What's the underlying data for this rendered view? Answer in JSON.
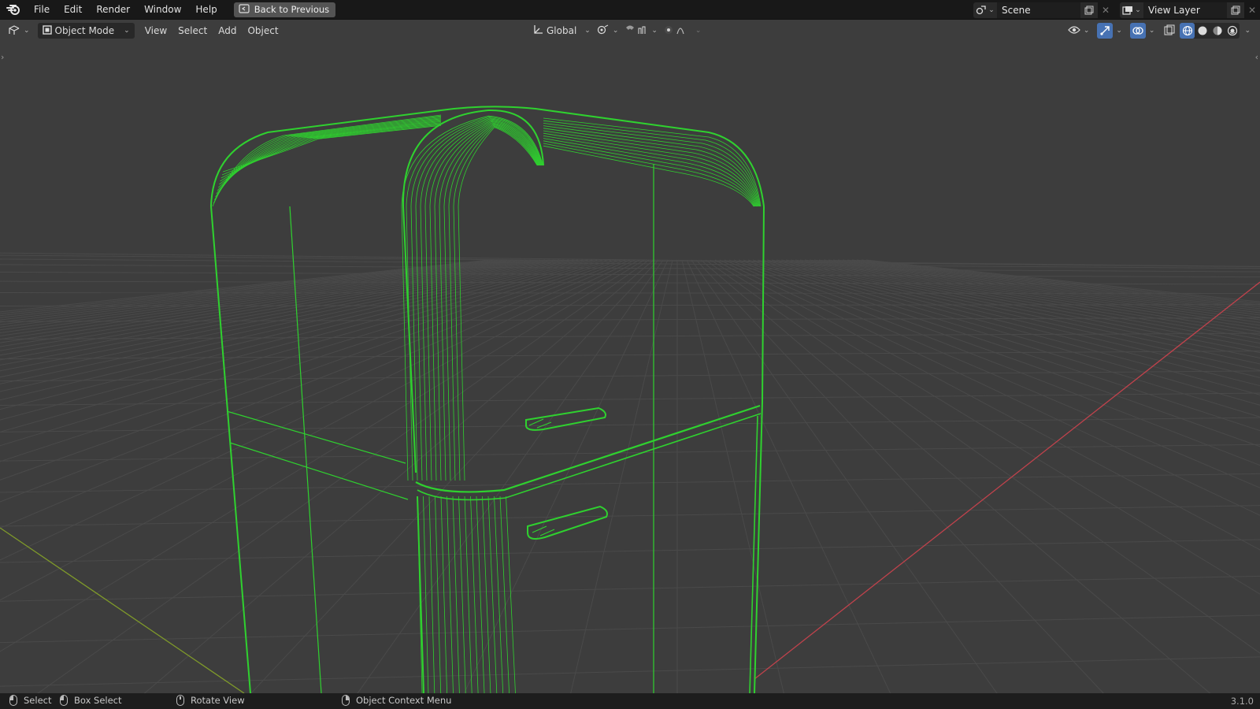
{
  "topbar": {
    "menus": [
      "File",
      "Edit",
      "Render",
      "Window",
      "Help"
    ],
    "back_label": "Back to Previous",
    "scene_name": "Scene",
    "view_layer_name": "View Layer"
  },
  "header": {
    "mode_label": "Object Mode",
    "menus": [
      "View",
      "Select",
      "Add",
      "Object"
    ],
    "orientation_label": "Global",
    "active_shading": "wireframe"
  },
  "statusbar": {
    "select": "Select",
    "box_select": "Box Select",
    "rotate_view": "Rotate View",
    "context_menu": "Object Context Menu",
    "version": "3.1.0"
  },
  "colors": {
    "wire": "#2fd12f",
    "x_axis": "#c0424c",
    "y_axis": "#7f9a2a",
    "grid": "#4a4a4a",
    "background": "#3d3d3d"
  },
  "icons": [
    "blender-logo-icon",
    "back-icon",
    "editor-type-icon",
    "object-mode-icon",
    "orientation-icon",
    "pivot-icon",
    "snap-icon",
    "proportional-edit-icon",
    "visibility-icon",
    "gizmo-icon",
    "overlay-icon",
    "xray-icon",
    "wireframe-shading-icon",
    "solid-shading-icon",
    "material-shading-icon",
    "rendered-shading-icon"
  ]
}
